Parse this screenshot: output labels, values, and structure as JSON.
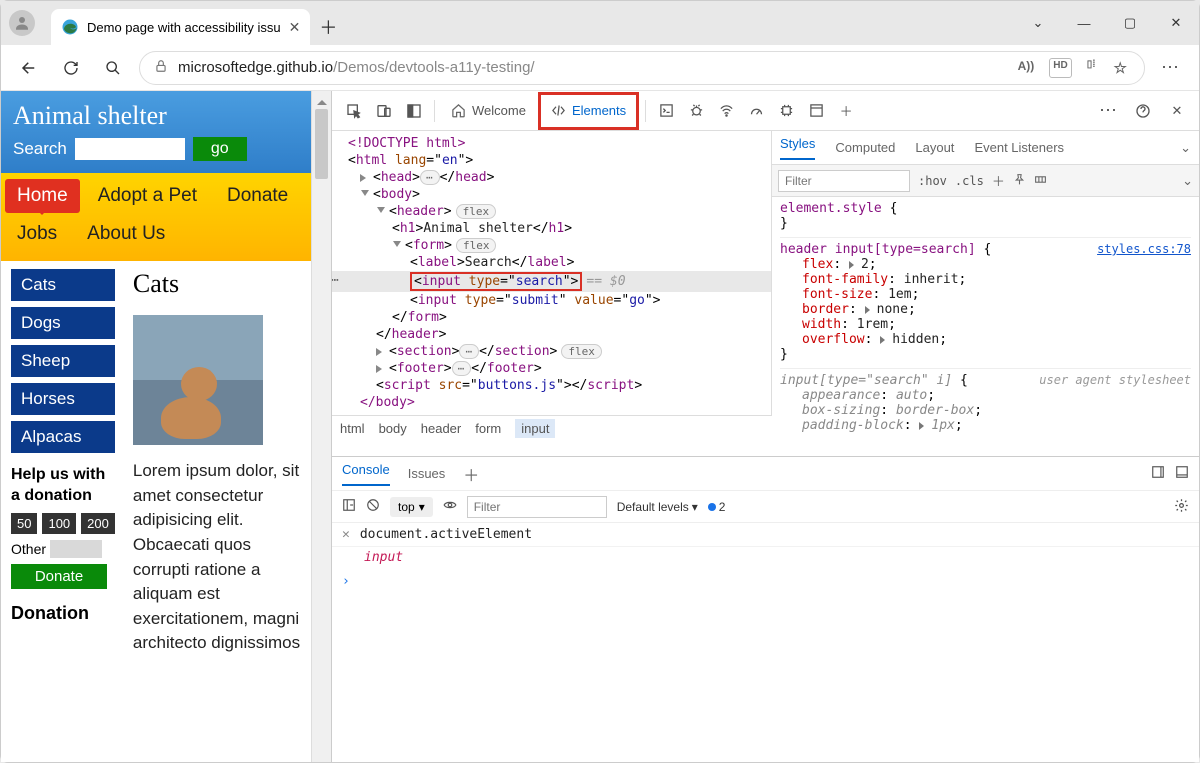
{
  "window": {
    "tab_title": "Demo page with accessibility issu"
  },
  "address_bar": {
    "domain": "microsoftedge.github.io",
    "path": "/Demos/devtools-a11y-testing/",
    "read_aloud_label": "A))",
    "hd_label": "HD"
  },
  "page": {
    "title": "Animal shelter",
    "search_label": "Search",
    "go_label": "go",
    "nav": [
      "Home",
      "Adopt a Pet",
      "Donate",
      "Jobs",
      "About Us"
    ],
    "sidebar": [
      "Cats",
      "Dogs",
      "Sheep",
      "Horses",
      "Alpacas"
    ],
    "help_heading": "Help us with a donation",
    "amounts": [
      "50",
      "100",
      "200"
    ],
    "other_label": "Other",
    "donate_btn": "Donate",
    "article_heading": "Cats",
    "article_text": "Lorem ipsum dolor, sit amet consectetur adipisicing elit. Obcaecati quos corrupti ratione a aliquam est exercitationem, magni architecto dignissimos",
    "donation_footer": "Donation"
  },
  "devtools": {
    "tabs": {
      "welcome": "Welcome",
      "elements": "Elements"
    },
    "dom": {
      "doctype": "<!DOCTYPE html>",
      "html_open": "html",
      "html_attr": "lang",
      "html_val": "en",
      "head": "head",
      "body": "body",
      "header": "header",
      "header_pill": "flex",
      "h1": "h1",
      "h1_text": "Animal shelter",
      "form": "form",
      "form_pill": "flex",
      "label": "label",
      "label_text": "Search",
      "input_search": "input",
      "input_search_attr": "type",
      "input_search_val": "search",
      "eq0": "== $0",
      "input_submit": "input",
      "submit_type_attr": "type",
      "submit_type_val": "submit",
      "submit_value_attr": "value",
      "submit_value_val": "go",
      "section": "section",
      "section_pill": "flex",
      "footer": "footer",
      "script": "script",
      "script_attr": "src",
      "script_val": "buttons.js"
    },
    "crumbs": [
      "html",
      "body",
      "header",
      "form",
      "input"
    ],
    "styles": {
      "tabs": [
        "Styles",
        "Computed",
        "Layout",
        "Event Listeners"
      ],
      "filter_placeholder": "Filter",
      "hov": ":hov",
      "cls": ".cls",
      "element_style": "element.style",
      "rule1_selector": "header input[type=search]",
      "rule1_link": "styles.css:78",
      "rule1_props": [
        [
          "flex",
          "2"
        ],
        [
          "font-family",
          "inherit"
        ],
        [
          "font-size",
          "1em"
        ],
        [
          "border",
          "none"
        ],
        [
          "width",
          "1rem"
        ],
        [
          "overflow",
          "hidden"
        ]
      ],
      "rule2_selector": "input[type=\"search\" i]",
      "rule2_ua": "user agent stylesheet",
      "rule2_props": [
        [
          "appearance",
          "auto"
        ],
        [
          "box-sizing",
          "border-box"
        ],
        [
          "padding-block",
          "1px"
        ]
      ]
    },
    "drawer": {
      "tabs": [
        "Console",
        "Issues"
      ],
      "context": "top",
      "filter_placeholder": "Filter",
      "levels": "Default levels",
      "issue_count": "2",
      "cmd": "document.activeElement",
      "result": "input"
    }
  }
}
